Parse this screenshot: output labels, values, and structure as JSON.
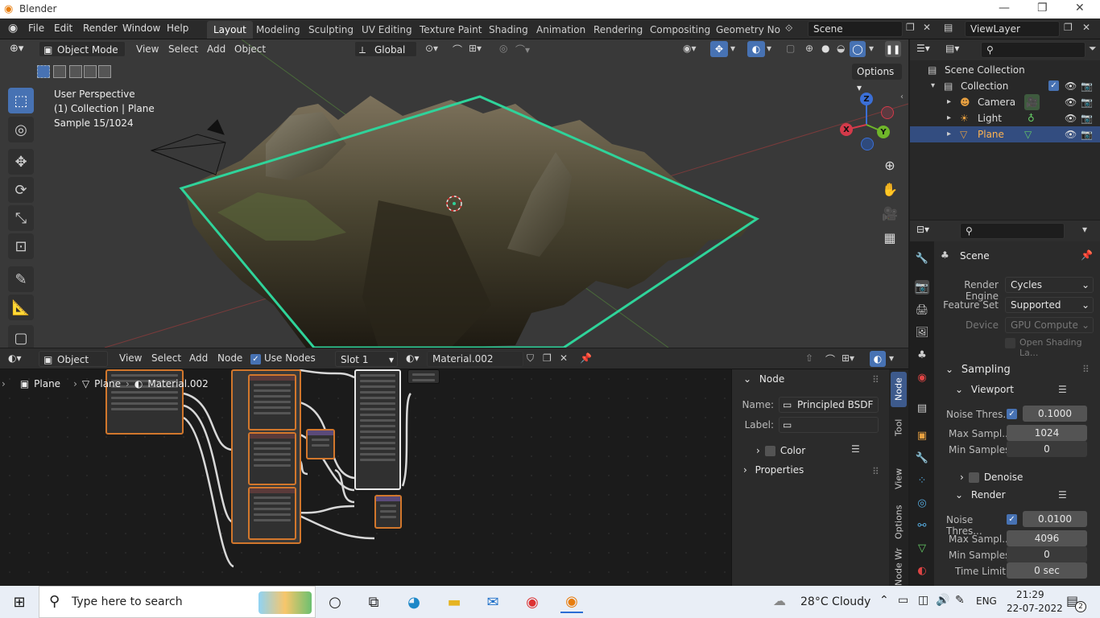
{
  "window": {
    "title": "Blender"
  },
  "menubar": {
    "items": [
      "File",
      "Edit",
      "Render",
      "Window",
      "Help"
    ]
  },
  "workspaces": {
    "tabs": [
      "Layout",
      "Modeling",
      "Sculpting",
      "UV Editing",
      "Texture Paint",
      "Shading",
      "Animation",
      "Rendering",
      "Compositing",
      "Geometry Noc"
    ],
    "active": "Layout"
  },
  "scene_selector": {
    "value": "Scene"
  },
  "viewlayer_selector": {
    "value": "ViewLayer"
  },
  "viewport": {
    "mode": "Object Mode",
    "menus": [
      "View",
      "Select",
      "Add",
      "Object"
    ],
    "transform_orientation": "Global",
    "options_label": "Options",
    "overlay": {
      "line1": "User Perspective",
      "line2": "(1) Collection | Plane",
      "line3": "Sample 15/1024"
    },
    "gizmo": {
      "x": "X",
      "y": "Y",
      "z": "Z"
    }
  },
  "node_editor": {
    "type": "Object",
    "menus": [
      "View",
      "Select",
      "Add",
      "Node"
    ],
    "use_nodes_label": "Use Nodes",
    "slot": "Slot 1",
    "material": "Material.002",
    "breadcrumb": [
      "Plane",
      "Plane",
      "Material.002"
    ],
    "npanel": {
      "section_node": "Node",
      "name_label": "Name:",
      "name_value": "Principled BSDF",
      "label_label": "Label:",
      "label_value": "",
      "color_label": "Color",
      "properties_label": "Properties"
    },
    "tabs": [
      "Node",
      "Tool",
      "View",
      "Options",
      "Node Wrangler"
    ]
  },
  "outliner": {
    "root": "Scene Collection",
    "collection": "Collection",
    "items": [
      {
        "label": "Camera"
      },
      {
        "label": "Light"
      },
      {
        "label": "Plane"
      }
    ]
  },
  "properties": {
    "context": "Scene",
    "render_engine_label": "Render Engine",
    "render_engine": "Cycles",
    "feature_set_label": "Feature Set",
    "feature_set": "Supported",
    "device_label": "Device",
    "device": "GPU Compute",
    "osl_label": "Open Shading La...",
    "sampling_label": "Sampling",
    "viewport_label": "Viewport",
    "viewport_noise_label": "Noise Thres...",
    "viewport_noise_value": "0.1000",
    "viewport_max_label": "Max Sampl...",
    "viewport_max_value": "1024",
    "viewport_min_label": "Min Samples",
    "viewport_min_value": "0",
    "denoise_label": "Denoise",
    "render_label": "Render",
    "render_noise_label": "Noise Thres...",
    "render_noise_value": "0.0100",
    "render_max_label": "Max Sampl...",
    "render_max_value": "4096",
    "render_min_label": "Min Samples",
    "render_min_value": "0",
    "time_limit_label": "Time Limit",
    "time_limit_value": "0 sec"
  },
  "taskbar": {
    "search_placeholder": "Type here to search",
    "weather": "28°C  Cloudy",
    "language": "ENG",
    "time": "21:29",
    "date": "22-07-2022",
    "notifications": "2"
  },
  "colors": {
    "accent": "#4772b3",
    "selection_outline": "#2fd39a",
    "node_active": "#d2772c"
  }
}
